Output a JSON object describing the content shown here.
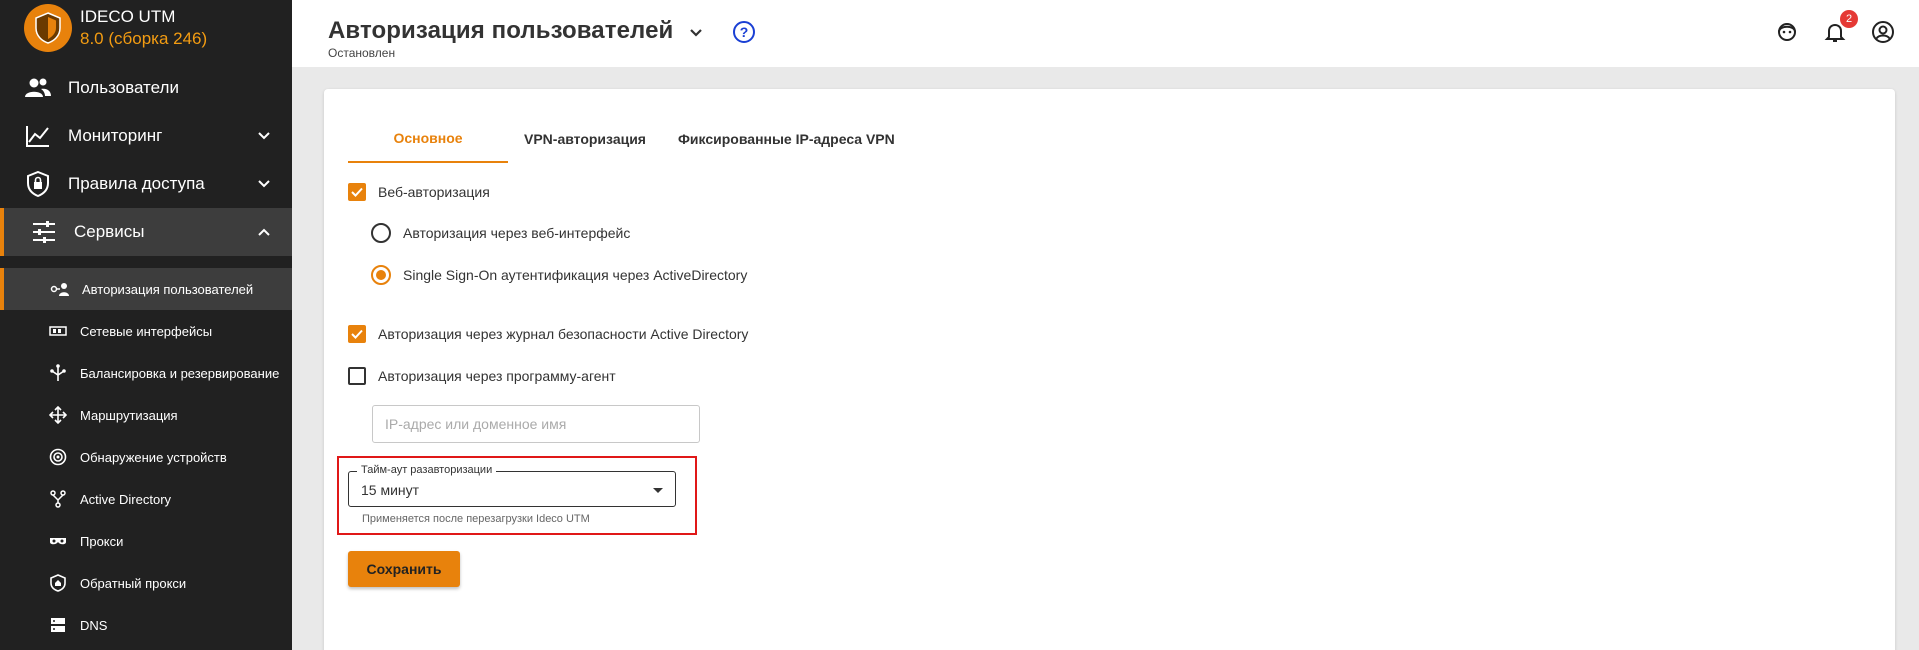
{
  "brand": {
    "name": "IDECO UTM",
    "version": "8.0 (сборка 246)"
  },
  "sidebar": {
    "main_items": [
      {
        "label": "Пользователи",
        "icon": "users-icon",
        "expandable": false
      },
      {
        "label": "Мониторинг",
        "icon": "chart-line-icon",
        "expandable": true
      },
      {
        "label": "Правила доступа",
        "icon": "shield-lock-icon",
        "expandable": true
      },
      {
        "label": "Сервисы",
        "icon": "tune-icon",
        "expandable": true,
        "expanded": true
      }
    ],
    "sub_items": [
      {
        "label": "Авторизация пользователей",
        "icon": "user-key-icon",
        "active": true
      },
      {
        "label": "Сетевые интерфейсы",
        "icon": "network-card-icon"
      },
      {
        "label": "Балансировка и резервирование",
        "icon": "balance-icon"
      },
      {
        "label": "Маршрутизация",
        "icon": "routing-icon"
      },
      {
        "label": "Обнаружение устройств",
        "icon": "radar-icon"
      },
      {
        "label": "Active Directory",
        "icon": "tree-icon"
      },
      {
        "label": "Прокси",
        "icon": "proxy-mask-icon"
      },
      {
        "label": "Обратный прокси",
        "icon": "shield-home-icon"
      },
      {
        "label": "DNS",
        "icon": "dns-icon"
      }
    ]
  },
  "header": {
    "title": "Авторизация пользователей",
    "status": "Остановлен",
    "notifications_count": "2"
  },
  "tabs": [
    {
      "label": "Основное",
      "active": true
    },
    {
      "label": "VPN-авторизация"
    },
    {
      "label": "Фиксированные IP-адреса VPN"
    }
  ],
  "form": {
    "web_auth": {
      "label": "Веб-авторизация",
      "checked": true
    },
    "radio_web": {
      "label": "Авторизация через веб-интерфейс",
      "selected": false
    },
    "radio_sso": {
      "label": "Single Sign-On аутентификация через ActiveDirectory",
      "selected": true
    },
    "ad_log_auth": {
      "label": "Авторизация через журнал безопасности Active Directory",
      "checked": true
    },
    "agent_auth": {
      "label": "Авторизация через программу-агент",
      "checked": false
    },
    "agent_host": {
      "placeholder": "IP-адрес или доменное имя",
      "value": ""
    },
    "timeout": {
      "label": "Тайм-аут разавторизации",
      "value": "15 минут",
      "helper": "Применяется после перезагрузки Ideco UTM"
    },
    "save_label": "Сохранить"
  },
  "colors": {
    "accent": "#e8820c",
    "sidebar_bg": "#212121",
    "highlight": "#e01818",
    "help": "#1a3fd4"
  }
}
